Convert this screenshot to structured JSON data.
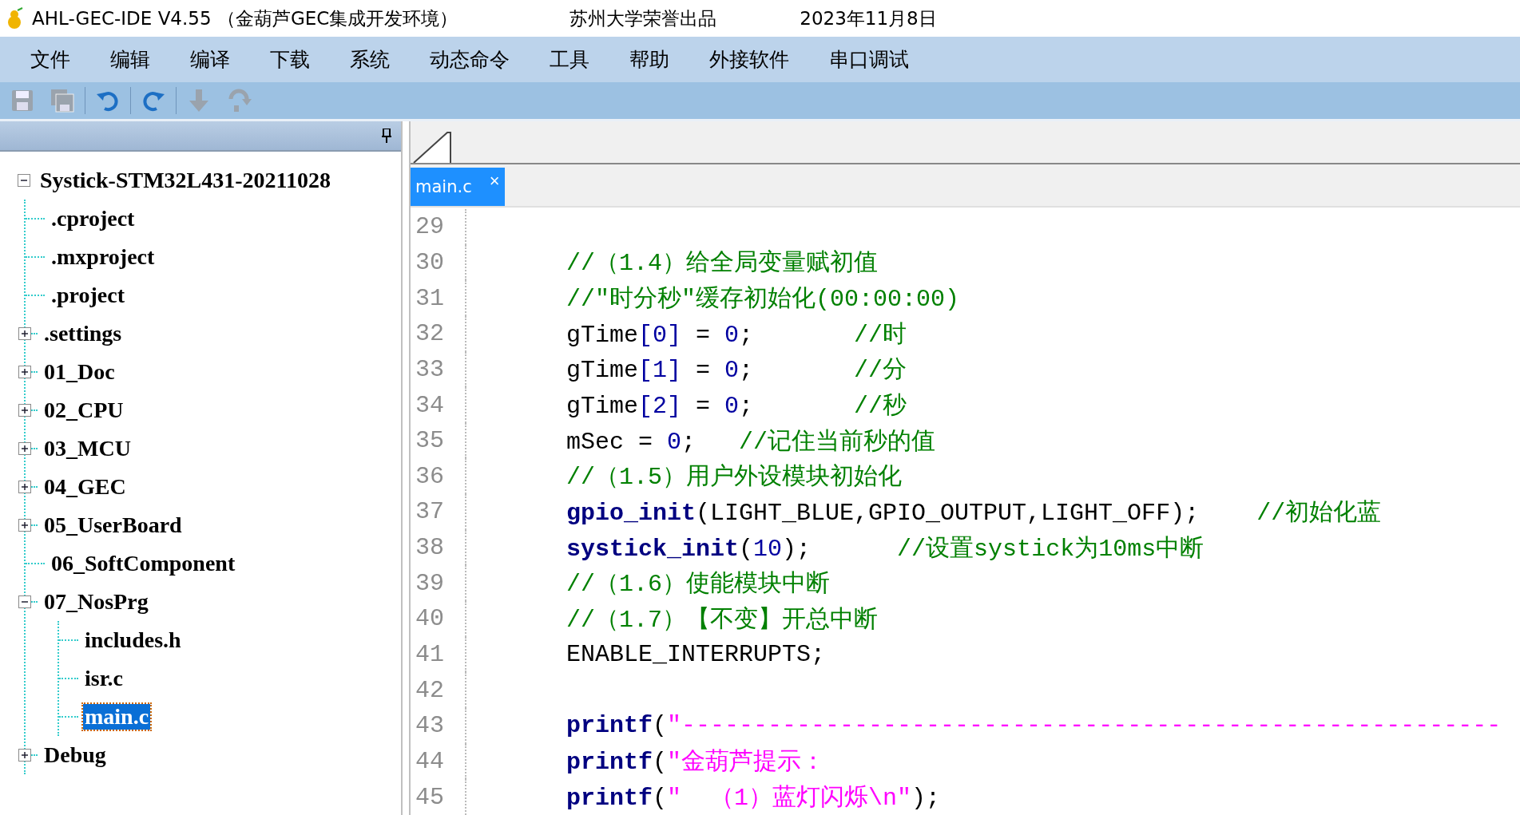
{
  "window": {
    "title": "AHL-GEC-IDE V4.55 （金葫芦GEC集成开发环境）",
    "subtitle": "苏州大学荣誉出品",
    "date": "2023年11月8日"
  },
  "menu": [
    "文件",
    "编辑",
    "编译",
    "下载",
    "系统",
    "动态命令",
    "工具",
    "帮助",
    "外接软件",
    "串口调试"
  ],
  "toolbar": [
    {
      "kind": "save",
      "disabled": true
    },
    {
      "kind": "save-all",
      "disabled": true
    },
    {
      "kind": "undo",
      "disabled": false
    },
    {
      "kind": "redo",
      "disabled": false
    },
    {
      "kind": "download",
      "disabled": true
    },
    {
      "kind": "refresh",
      "disabled": true
    }
  ],
  "tree": {
    "label": "Systick-STM32L431-20211028",
    "expanded": true,
    "selected": false,
    "children": [
      {
        "label": ".cproject",
        "selected": false
      },
      {
        "label": ".mxproject",
        "selected": false
      },
      {
        "label": ".project",
        "selected": false
      },
      {
        "label": ".settings",
        "expanded": false,
        "selected": false
      },
      {
        "label": "01_Doc",
        "expanded": false,
        "selected": false
      },
      {
        "label": "02_CPU",
        "expanded": false,
        "selected": false
      },
      {
        "label": "03_MCU",
        "expanded": false,
        "selected": false
      },
      {
        "label": "04_GEC",
        "expanded": false,
        "selected": false
      },
      {
        "label": "05_UserBoard",
        "expanded": false,
        "selected": false
      },
      {
        "label": "06_SoftComponent",
        "selected": false
      },
      {
        "label": "07_NosPrg",
        "expanded": true,
        "selected": false,
        "children": [
          {
            "label": "includes.h",
            "selected": false
          },
          {
            "label": "isr.c",
            "selected": false
          },
          {
            "label": "main.c",
            "selected": true
          }
        ]
      },
      {
        "label": "Debug",
        "expanded": false,
        "selected": false
      }
    ]
  },
  "editor": {
    "tabs": [
      {
        "label": "main.c",
        "selected": true,
        "close": "×"
      }
    ],
    "lines": [
      {
        "number": "29"
      },
      {
        "number": "30",
        "tokens": [
          {
            "kind": "comment",
            "text": "//（1.4）给全局变量赋初值"
          }
        ]
      },
      {
        "number": "31",
        "tokens": [
          {
            "kind": "comment",
            "text": "//\"时分秒\"缓存初始化(00:00:00)"
          }
        ]
      },
      {
        "number": "32",
        "tokens": [
          {
            "kind": "plain",
            "text": "gTime"
          },
          {
            "kind": "num",
            "text": "[0]"
          },
          {
            "kind": "plain",
            "text": " = "
          },
          {
            "kind": "num",
            "text": "0"
          },
          {
            "kind": "plain",
            "text": ";       "
          },
          {
            "kind": "comment",
            "text": "//时"
          }
        ]
      },
      {
        "number": "33",
        "tokens": [
          {
            "kind": "plain",
            "text": "gTime"
          },
          {
            "kind": "num",
            "text": "[1]"
          },
          {
            "kind": "plain",
            "text": " = "
          },
          {
            "kind": "num",
            "text": "0"
          },
          {
            "kind": "plain",
            "text": ";       "
          },
          {
            "kind": "comment",
            "text": "//分"
          }
        ]
      },
      {
        "number": "34",
        "tokens": [
          {
            "kind": "plain",
            "text": "gTime"
          },
          {
            "kind": "num",
            "text": "[2]"
          },
          {
            "kind": "plain",
            "text": " = "
          },
          {
            "kind": "num",
            "text": "0"
          },
          {
            "kind": "plain",
            "text": ";       "
          },
          {
            "kind": "comment",
            "text": "//秒"
          }
        ]
      },
      {
        "number": "35",
        "tokens": [
          {
            "kind": "plain",
            "text": "mSec = "
          },
          {
            "kind": "num",
            "text": "0"
          },
          {
            "kind": "plain",
            "text": ";   "
          },
          {
            "kind": "comment",
            "text": "//记住当前秒的值"
          }
        ]
      },
      {
        "number": "36",
        "tokens": [
          {
            "kind": "comment",
            "text": "//（1.5）用户外设模块初始化"
          }
        ]
      },
      {
        "number": "37",
        "tokens": [
          {
            "kind": "func",
            "text": "gpio_init"
          },
          {
            "kind": "plain",
            "text": "(LIGHT_BLUE,GPIO_OUTPUT,LIGHT_OFF);    "
          },
          {
            "kind": "comment",
            "text": "//初始化蓝"
          }
        ]
      },
      {
        "number": "38",
        "tokens": [
          {
            "kind": "func",
            "text": "systick_init"
          },
          {
            "kind": "plain",
            "text": "("
          },
          {
            "kind": "num",
            "text": "10"
          },
          {
            "kind": "plain",
            "text": ");      "
          },
          {
            "kind": "comment",
            "text": "//设置systick为10ms中断"
          }
        ]
      },
      {
        "number": "39",
        "tokens": [
          {
            "kind": "comment",
            "text": "//（1.6）使能模块中断"
          }
        ]
      },
      {
        "number": "40",
        "tokens": [
          {
            "kind": "comment",
            "text": "//（1.7）【不变】开总中断"
          }
        ]
      },
      {
        "number": "41",
        "tokens": [
          {
            "kind": "plain",
            "text": "ENABLE_INTERRUPTS;"
          }
        ]
      },
      {
        "number": "42"
      },
      {
        "number": "43",
        "tokens": [
          {
            "kind": "func",
            "text": "printf"
          },
          {
            "kind": "plain",
            "text": "("
          },
          {
            "kind": "string",
            "text": "\"---------------------------------------------------------"
          }
        ]
      },
      {
        "number": "44",
        "tokens": [
          {
            "kind": "func",
            "text": "printf"
          },
          {
            "kind": "plain",
            "text": "("
          },
          {
            "kind": "string",
            "text": "\"金葫芦提示："
          }
        ]
      },
      {
        "number": "45",
        "tokens": [
          {
            "kind": "func",
            "text": "printf"
          },
          {
            "kind": "plain",
            "text": "("
          },
          {
            "kind": "string",
            "text": "\"  （1）蓝灯闪烁\\n\""
          },
          {
            "kind": "plain",
            "text": ");"
          }
        ]
      }
    ]
  }
}
